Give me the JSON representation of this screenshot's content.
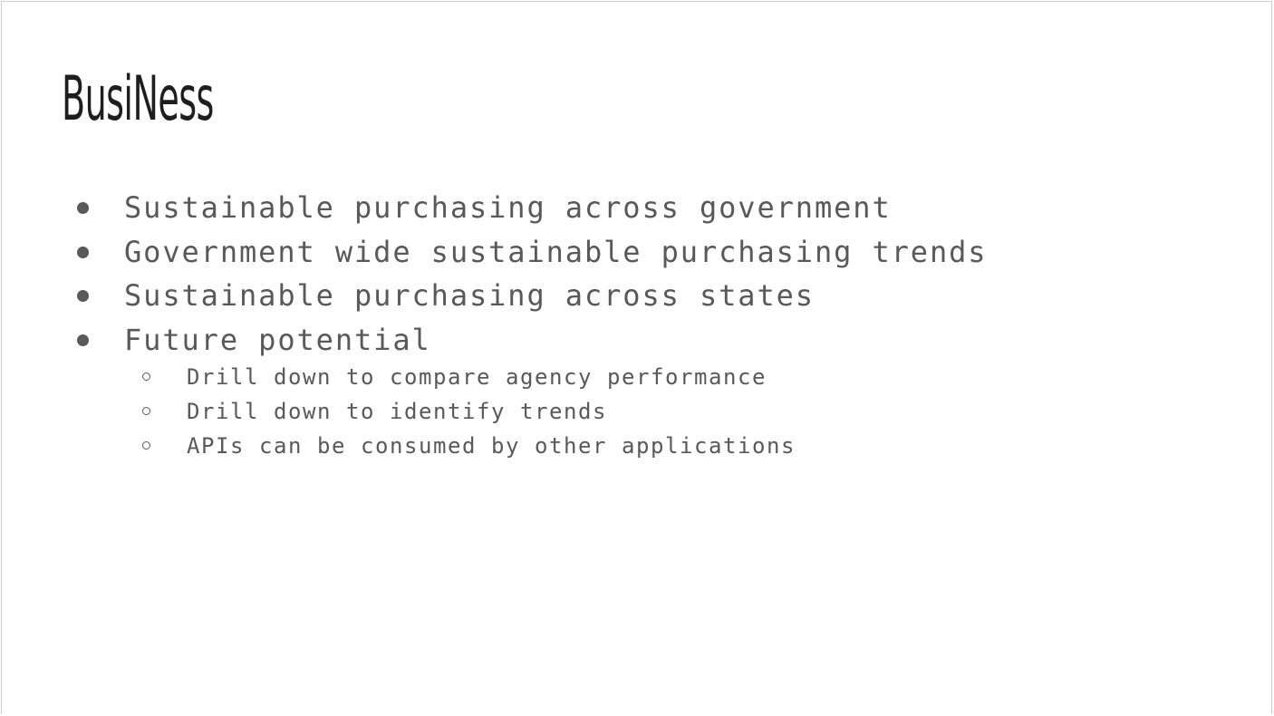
{
  "slide": {
    "title": "BusiNess",
    "bullets": [
      "Sustainable purchasing across government",
      "Government wide sustainable purchasing trends",
      "Sustainable purchasing across states",
      "Future potential"
    ],
    "sub_bullets": [
      "Drill down to compare agency performance",
      "Drill down to identify trends",
      "APIs can be consumed by other applications"
    ]
  },
  "colors": {
    "title": "#1e1e1e",
    "body_text": "#595959",
    "background": "#ffffff",
    "border": "#cfcfcf"
  }
}
